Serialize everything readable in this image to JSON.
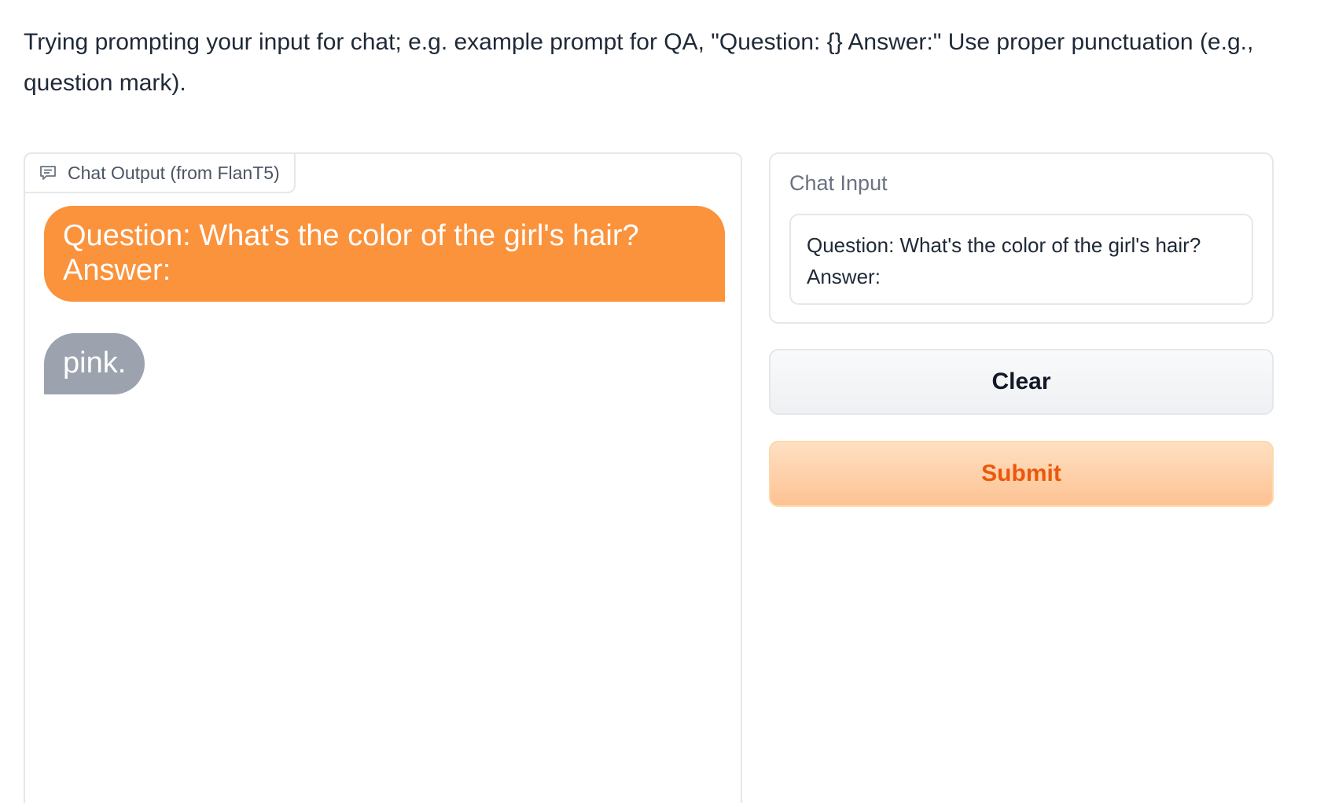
{
  "instructions": "Trying prompting your input for chat; e.g. example prompt for QA, \"Question: {} Answer:\" Use proper punctuation (e.g., question mark).",
  "chat_output": {
    "label": "Chat Output (from FlanT5)",
    "icon": "chat-bubble-icon",
    "messages": [
      {
        "role": "user",
        "text": "Question: What's the color of the girl's hair?\nAnswer:"
      },
      {
        "role": "bot",
        "text": "pink."
      }
    ]
  },
  "chat_input": {
    "label": "Chat Input",
    "value": "Question: What's the color of the girl's hair?\nAnswer:"
  },
  "buttons": {
    "clear_label": "Clear",
    "submit_label": "Submit"
  },
  "colors": {
    "user_bubble": "#fb923c",
    "bot_bubble": "#9ca3af",
    "submit_text": "#ea580c"
  }
}
